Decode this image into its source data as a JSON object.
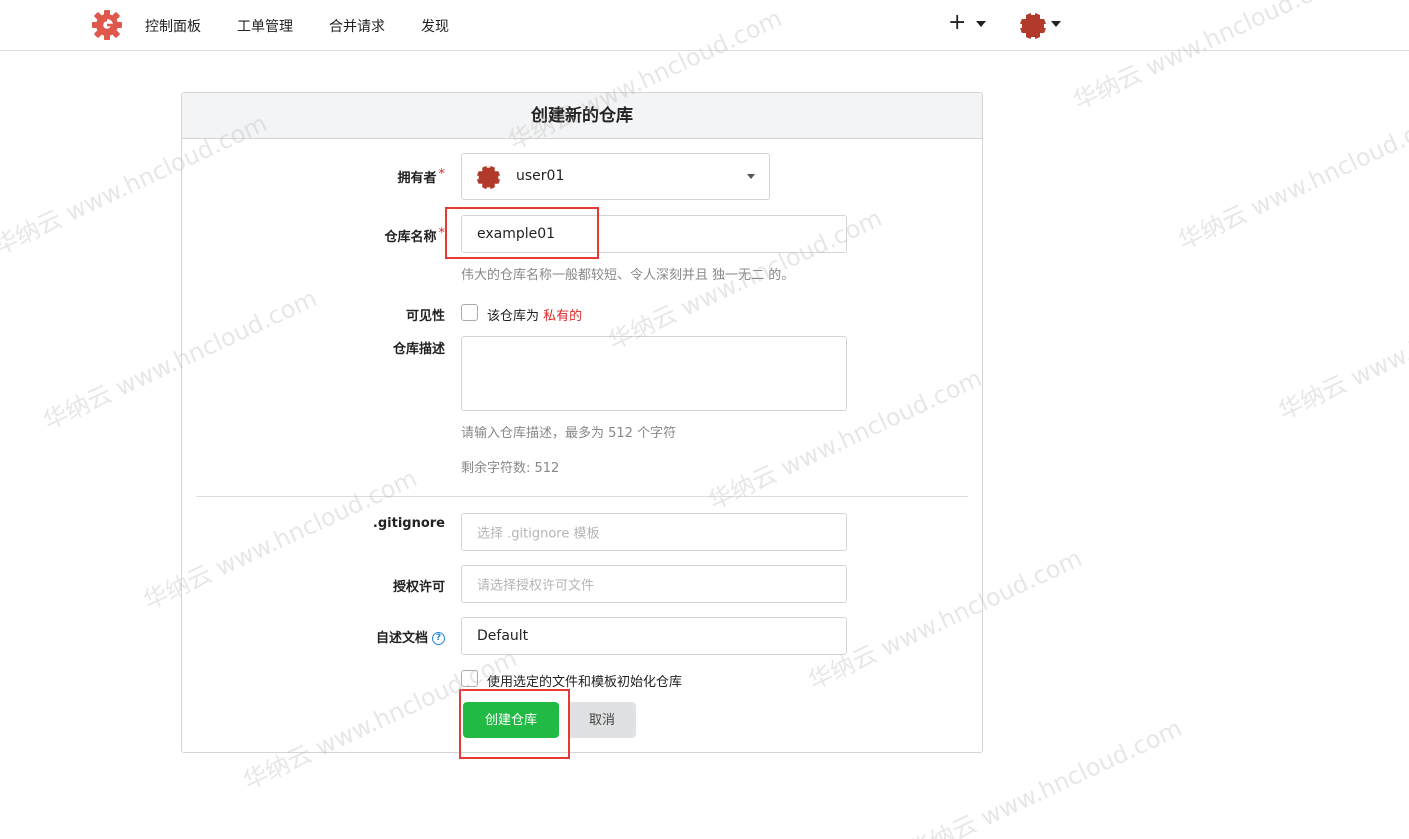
{
  "nav": {
    "items": [
      "控制面板",
      "工单管理",
      "合并请求",
      "发现"
    ],
    "plus": "+"
  },
  "form": {
    "title": "创建新的仓库",
    "owner": {
      "label": "拥有者",
      "required_mark": "*",
      "value": "user01"
    },
    "repo_name": {
      "label": "仓库名称",
      "required_mark": "*",
      "value": "example01",
      "help": "伟大的仓库名称一般都较短、令人深刻并且 独一无二 的。"
    },
    "visibility": {
      "label": "可见性",
      "text_prefix": "该仓库为",
      "text_private": "私有的"
    },
    "description": {
      "label": "仓库描述",
      "help": "请输入仓库描述，最多为 512 个字符",
      "remaining": "剩余字符数: 512"
    },
    "gitignore": {
      "label": ".gitignore",
      "placeholder": "选择 .gitignore 模板"
    },
    "license": {
      "label": "授权许可",
      "placeholder": "请选择授权许可文件"
    },
    "readme": {
      "label": "自述文档",
      "help_glyph": "?",
      "value": "Default"
    },
    "init": {
      "label": "使用选定的文件和模板初始化仓库"
    },
    "create_button": "创建仓库",
    "cancel_button": "取消"
  },
  "watermark": "华纳云 www.hncloud.com",
  "colors": {
    "primary": "#21ba45",
    "required": "#db2828",
    "highlight": "#e53935",
    "logo": "#e0574c"
  }
}
